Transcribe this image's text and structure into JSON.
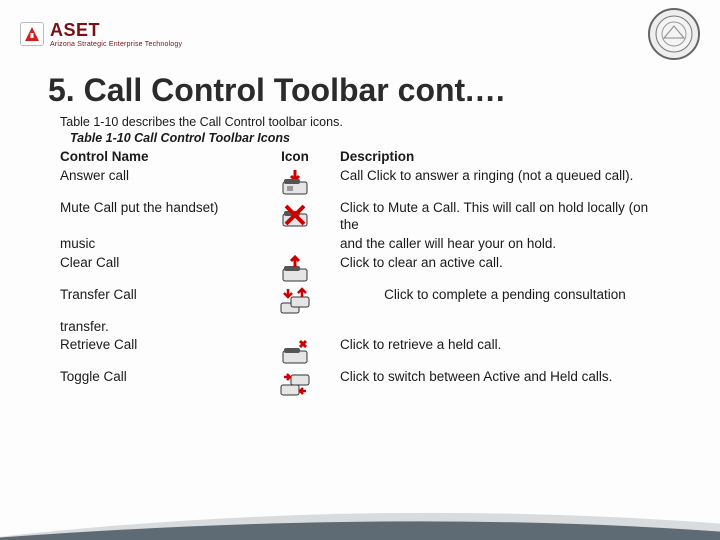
{
  "header": {
    "logo_text": "ASET",
    "logo_sub": "Arizona Strategic Enterprise Technology",
    "seal_label": "State Seal"
  },
  "title": "5. Call Control Toolbar cont.…",
  "intro": "Table 1-10 describes the Call Control toolbar icons.",
  "caption": "Table 1-10 Call Control Toolbar Icons",
  "columns": {
    "name": "Control Name",
    "icon": "Icon",
    "desc": "Description"
  },
  "rows": [
    {
      "name": "Answer call",
      "icon": "answer",
      "desc": "Call Click to answer a ringing (not a queued call)."
    },
    {
      "name": "Mute Call put the handset)",
      "icon": "mute",
      "desc": "Click to Mute a Call. This will call on hold locally (on the"
    },
    {
      "name": "music",
      "icon": "",
      "desc": "and the caller will hear your on hold."
    },
    {
      "name": "Clear Call",
      "icon": "clear",
      "desc": "Click to clear an active call."
    },
    {
      "name": "Transfer Call",
      "icon": "transfer",
      "desc": "Click to complete a pending consultation"
    },
    {
      "name": "transfer.",
      "icon": "",
      "desc": ""
    },
    {
      "name": "Retrieve Call",
      "icon": "retrieve",
      "desc": "Click to retrieve a held call."
    },
    {
      "name": "Toggle Call",
      "icon": "toggle",
      "desc": "Click to switch between Active and Held calls."
    }
  ]
}
